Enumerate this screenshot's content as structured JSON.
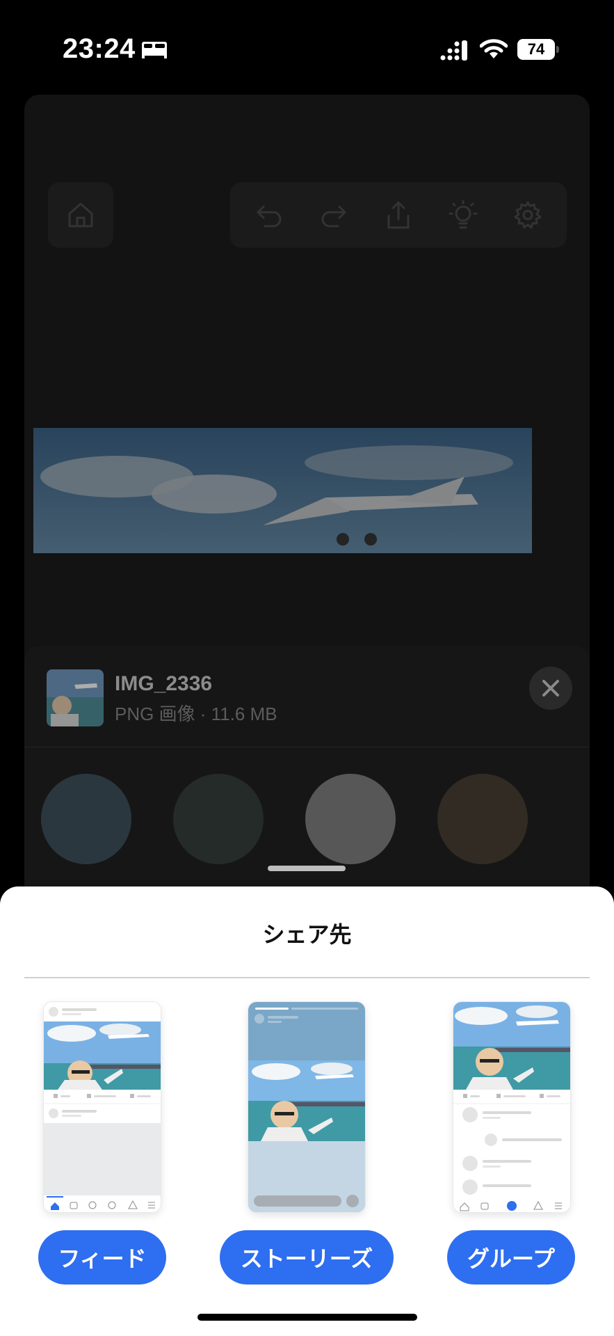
{
  "status_bar": {
    "time": "23:24",
    "battery": "74",
    "icons": [
      "bed-icon",
      "signal-icon",
      "wifi-icon",
      "battery-icon"
    ]
  },
  "background_app": {
    "toolbar_icons": [
      "home-icon",
      "undo-icon",
      "redo-icon",
      "share-icon",
      "lightbulb-icon",
      "settings-icon"
    ]
  },
  "share_sheet": {
    "file_name": "IMG_2336",
    "file_meta": "PNG 画像 · 11.6 MB",
    "close_icon": "close-icon"
  },
  "modal": {
    "title": "シェア先",
    "options": [
      {
        "label": "フィード",
        "preview": "feed-preview"
      },
      {
        "label": "ストーリーズ",
        "preview": "stories-preview"
      },
      {
        "label": "グループ",
        "preview": "groups-preview"
      }
    ]
  },
  "colors": {
    "accent": "#2e6ef0",
    "sheet_bg": "#ffffff",
    "dim_bg": "#131313"
  }
}
